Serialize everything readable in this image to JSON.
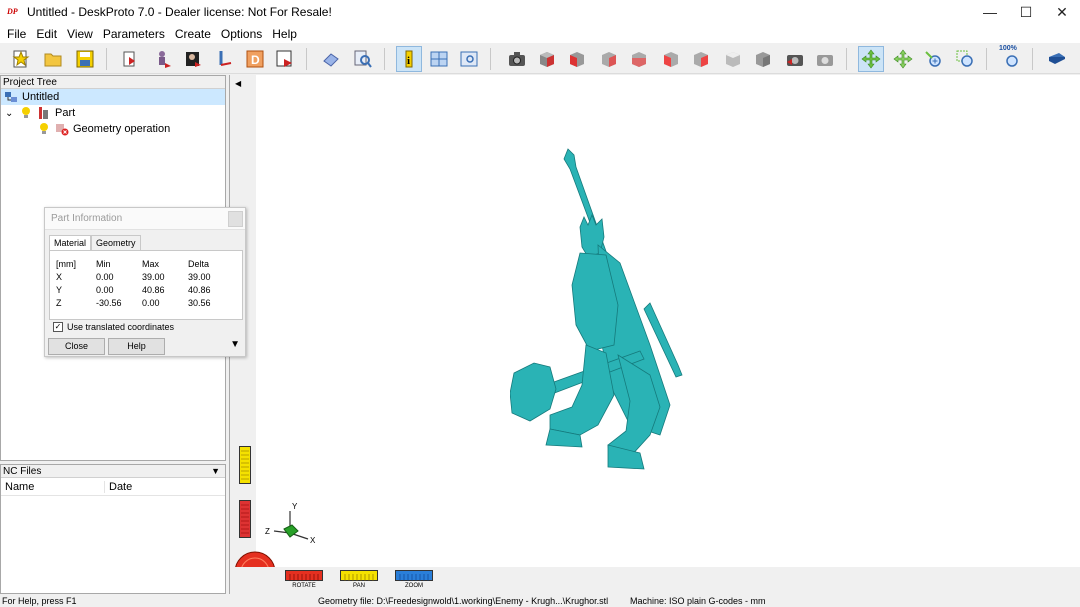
{
  "window": {
    "title": "Untitled - DeskProto 7.0 - Dealer license: Not For Resale!",
    "icon_text": "DP",
    "minimize_glyph": "—",
    "maximize_glyph": "☐",
    "close_glyph": "✕"
  },
  "menu": [
    "File",
    "Edit",
    "View",
    "Parameters",
    "Create",
    "Options",
    "Help"
  ],
  "toolbar": {
    "zoom_label": "100%"
  },
  "project_tree": {
    "header": "Project Tree",
    "items": [
      {
        "label": "Untitled",
        "icon": "project-icon",
        "selected": true
      },
      {
        "label": "Part",
        "icon": "part-icon"
      },
      {
        "label": "Geometry operation",
        "icon": "geometry-operation-icon"
      }
    ],
    "expander": "⌄"
  },
  "nc_files": {
    "header": "NC Files",
    "columns": [
      "Name",
      "Date"
    ]
  },
  "dialog": {
    "title": "Part Information",
    "tabs": [
      "Material",
      "Geometry"
    ],
    "active_tab": "Material",
    "table": {
      "headers": [
        "[mm]",
        "Min",
        "Max",
        "Delta"
      ],
      "rows": [
        [
          "X",
          "0.00",
          "39.00",
          "39.00"
        ],
        [
          "Y",
          "0.00",
          "40.86",
          "40.86"
        ],
        [
          "Z",
          "-30.56",
          "0.00",
          "30.56"
        ]
      ]
    },
    "checkbox_label": "Use translated coordinates",
    "checkbox_checked": true,
    "close_label": "Close",
    "help_label": "Help"
  },
  "viewport": {
    "model_color": "#2ab3b5",
    "axes": {
      "x": "X",
      "y": "Y",
      "z": "Z"
    },
    "nav": {
      "rotate": "ROTATE",
      "pan": "PAN",
      "zoom": "ZOOM"
    }
  },
  "status": {
    "help": "For Help, press F1",
    "geometry_file": "Geometry file: D:\\Freedesignwold\\1.working\\Enemy - Krugh...\\Krughor.stl",
    "machine": "Machine: ISO plain G-codes - mm"
  }
}
